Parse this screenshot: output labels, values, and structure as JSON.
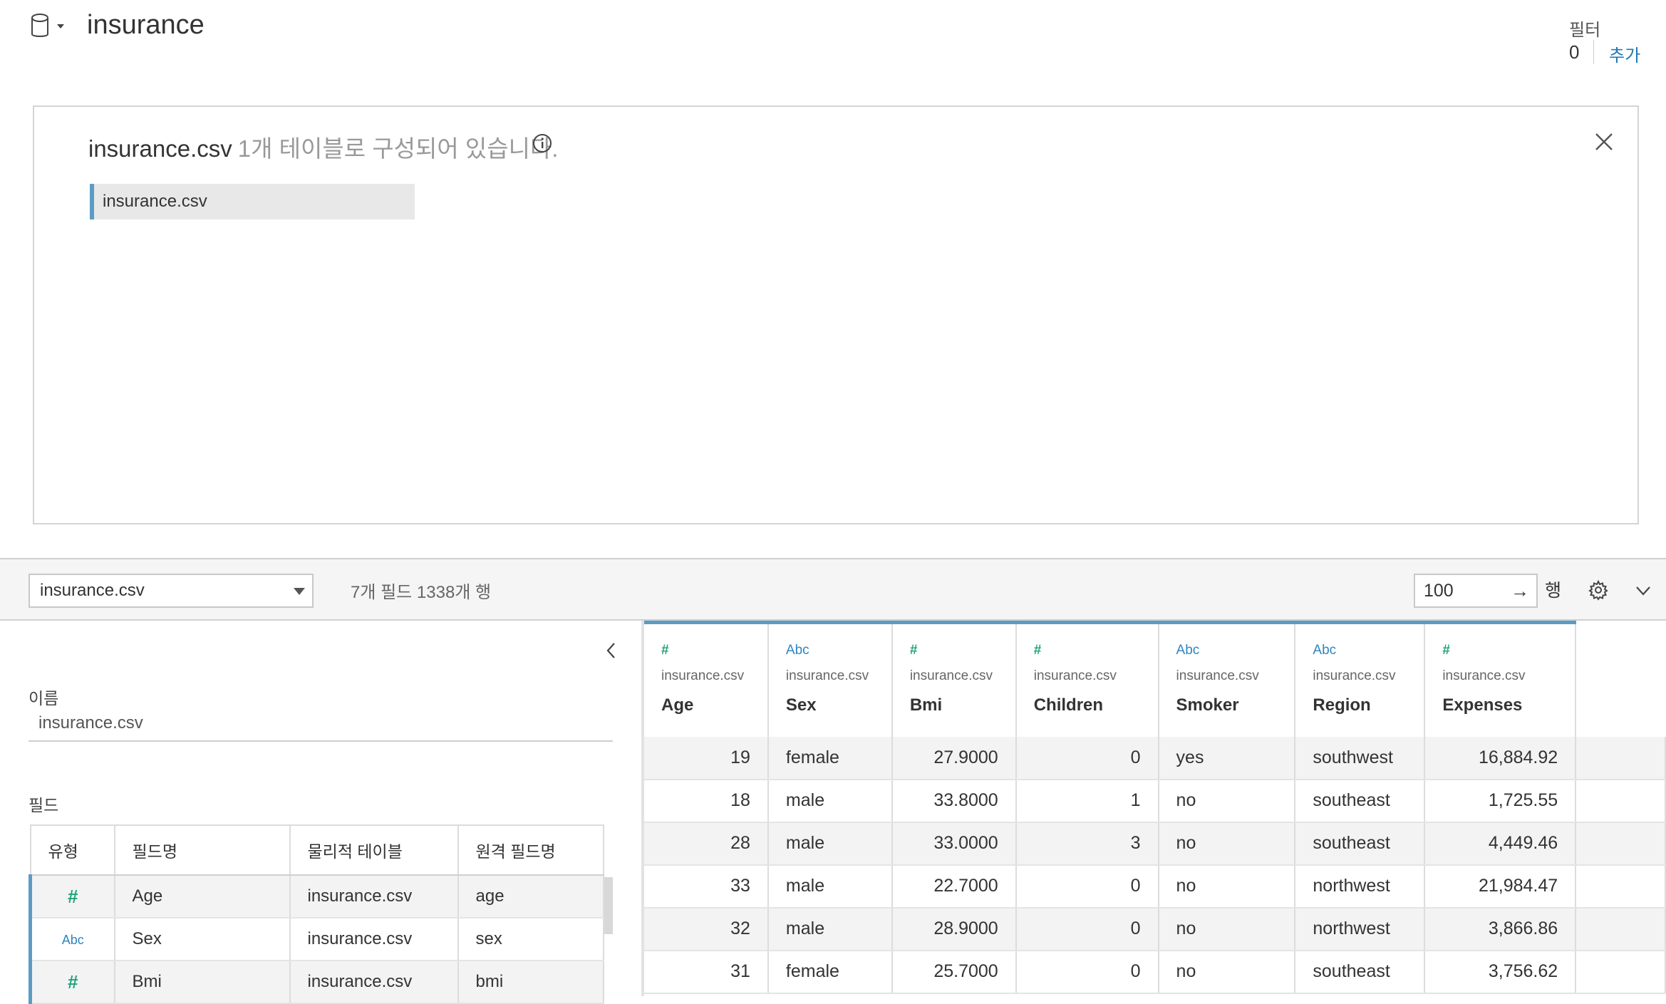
{
  "header": {
    "datasource_title": "insurance",
    "filter_label": "필터",
    "filter_count": "0",
    "filter_add": "추가"
  },
  "canvas": {
    "file_name": "insurance.csv",
    "description": "1개 테이블로 구성되어 있습니다.",
    "table_pill": "insurance.csv"
  },
  "toolbar": {
    "selected_table": "insurance.csv",
    "meta": "7개 필드 1338개 행",
    "rows_value": "100",
    "rows_arrow": "→",
    "rows_label": "행"
  },
  "left_panel": {
    "name_label": "이름",
    "name_value": "insurance.csv",
    "fields_label": "필드",
    "columns": [
      "유형",
      "필드명",
      "물리적 테이블",
      "원격 필드명"
    ],
    "rows": [
      {
        "type_icon": "#",
        "type": "number",
        "name": "Age",
        "table": "insurance.csv",
        "remote": "age"
      },
      {
        "type_icon": "Abc",
        "type": "string",
        "name": "Sex",
        "table": "insurance.csv",
        "remote": "sex"
      },
      {
        "type_icon": "#",
        "type": "number",
        "name": "Bmi",
        "table": "insurance.csv",
        "remote": "bmi"
      }
    ]
  },
  "grid": {
    "columns": [
      {
        "type_icon": "#",
        "type": "number",
        "source": "insurance.csv",
        "name": "Age"
      },
      {
        "type_icon": "Abc",
        "type": "string",
        "source": "insurance.csv",
        "name": "Sex"
      },
      {
        "type_icon": "#",
        "type": "number",
        "source": "insurance.csv",
        "name": "Bmi"
      },
      {
        "type_icon": "#",
        "type": "number",
        "source": "insurance.csv",
        "name": "Children"
      },
      {
        "type_icon": "Abc",
        "type": "string",
        "source": "insurance.csv",
        "name": "Smoker"
      },
      {
        "type_icon": "Abc",
        "type": "string",
        "source": "insurance.csv",
        "name": "Region"
      },
      {
        "type_icon": "#",
        "type": "number",
        "source": "insurance.csv",
        "name": "Expenses"
      }
    ],
    "rows": [
      [
        "19",
        "female",
        "27.9000",
        "0",
        "yes",
        "southwest",
        "16,884.92"
      ],
      [
        "18",
        "male",
        "33.8000",
        "1",
        "no",
        "southeast",
        "1,725.55"
      ],
      [
        "28",
        "male",
        "33.0000",
        "3",
        "no",
        "southeast",
        "4,449.46"
      ],
      [
        "33",
        "male",
        "22.7000",
        "0",
        "no",
        "northwest",
        "21,984.47"
      ],
      [
        "32",
        "male",
        "28.9000",
        "0",
        "no",
        "northwest",
        "3,866.86"
      ],
      [
        "31",
        "female",
        "25.7000",
        "0",
        "no",
        "southeast",
        "3,756.62"
      ]
    ]
  },
  "colors": {
    "accent": "#5b9cc4",
    "link": "#1f77b4",
    "number_icon": "#1fa37a",
    "string_icon": "#2f85c0"
  }
}
